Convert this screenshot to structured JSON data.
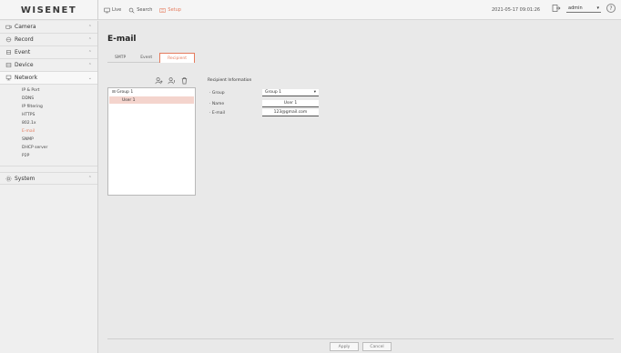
{
  "app": {
    "logo": "WISENET"
  },
  "topnav": [
    {
      "label": "Live",
      "icon": "monitor-icon"
    },
    {
      "label": "Search",
      "icon": "search-icon"
    },
    {
      "label": "Setup",
      "icon": "setup-icon",
      "active": true
    }
  ],
  "header": {
    "datetime": "2021-05-17 09:01:26",
    "user": "admin",
    "help": "?"
  },
  "sidebar": {
    "items": [
      {
        "label": "Camera",
        "icon": "camera-icon"
      },
      {
        "label": "Record",
        "icon": "record-icon"
      },
      {
        "label": "Event",
        "icon": "event-icon"
      },
      {
        "label": "Device",
        "icon": "device-icon"
      },
      {
        "label": "Network",
        "icon": "network-icon",
        "expanded": true
      }
    ],
    "network_sub": [
      "IP & Port",
      "DDNS",
      "IP filtering",
      "HTTPS",
      "802.1x",
      "E-mail",
      "SNMP",
      "DHCP server",
      "P2P"
    ],
    "system": {
      "label": "System",
      "icon": "gear-icon"
    }
  },
  "main": {
    "title": "E-mail",
    "tabs": [
      {
        "label": "SMTP"
      },
      {
        "label": "Event"
      },
      {
        "label": "Recipient",
        "active": true
      }
    ],
    "tree": {
      "root": "Group 1",
      "child": "User 1"
    },
    "info_title": "Recipient Information",
    "fields": {
      "group": {
        "label": "Group",
        "value": "Group 1"
      },
      "name": {
        "label": "Name",
        "value": "User 1"
      },
      "email": {
        "label": "E-mail",
        "value": "123@gmail.com"
      }
    },
    "buttons": {
      "apply": "Apply",
      "cancel": "Cancel"
    }
  },
  "colors": {
    "accent": "#e57b5d",
    "selection": "#f4d4cd"
  }
}
